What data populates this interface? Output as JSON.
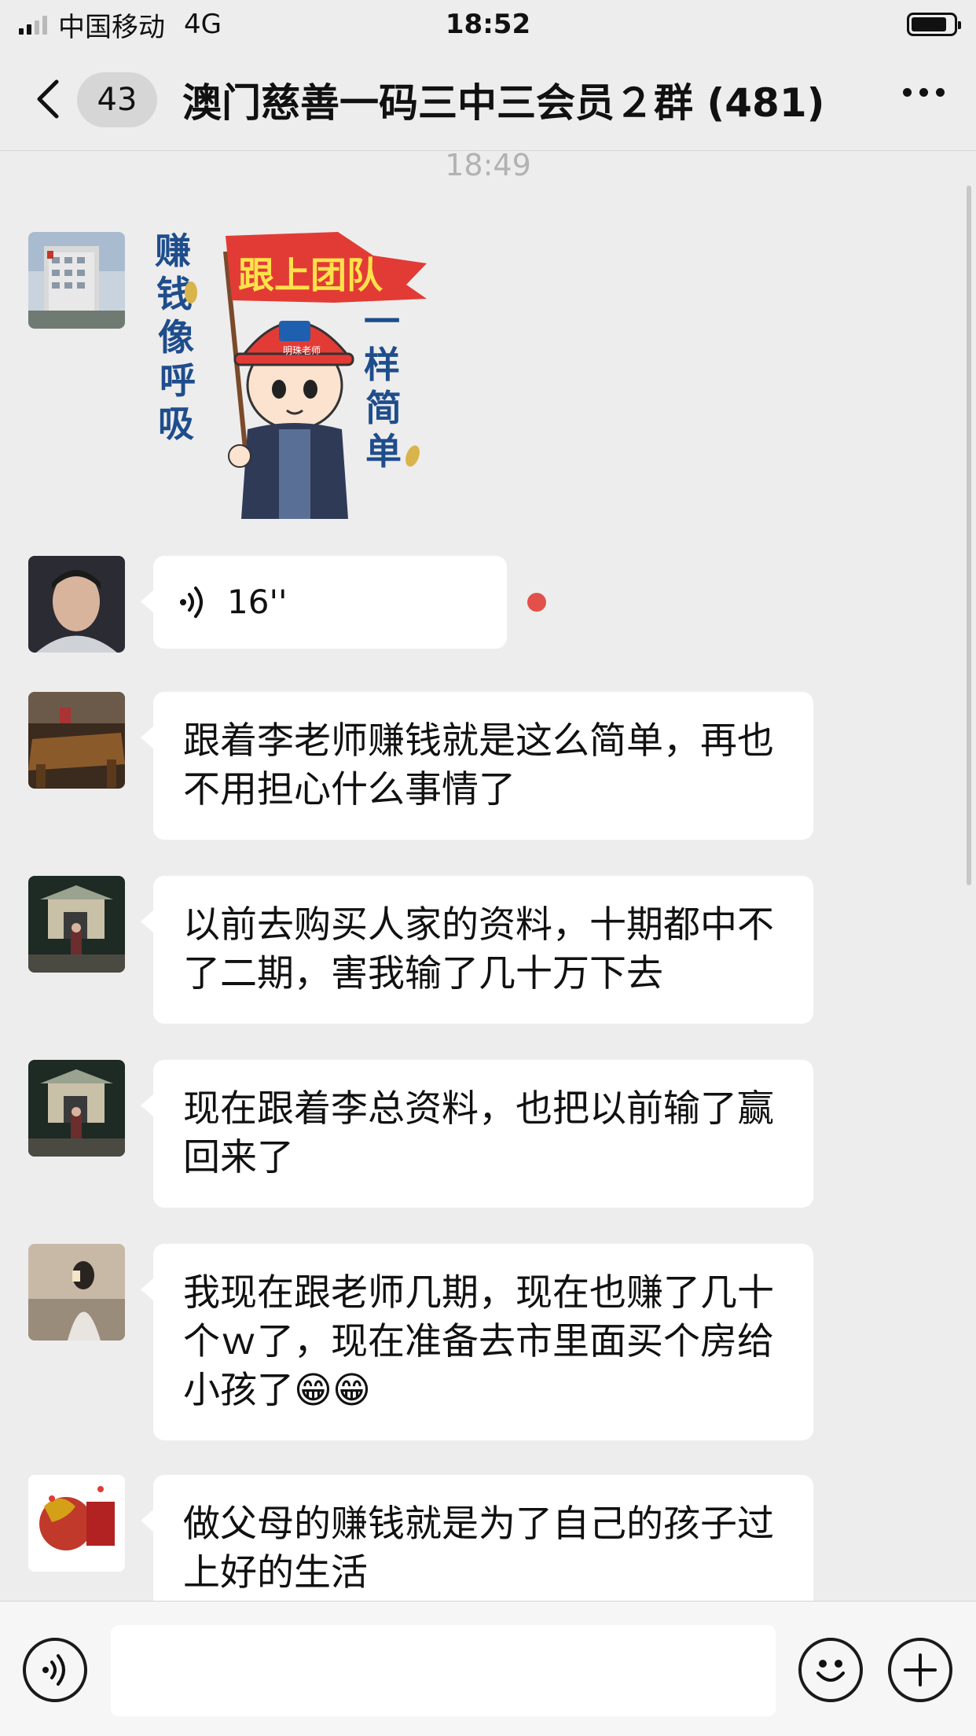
{
  "status_bar": {
    "carrier": "中国移动",
    "network": "4G",
    "time": "18:52"
  },
  "nav": {
    "unread_count": "43",
    "title": "澳门慈善一码三中三会员２群 (481)"
  },
  "chat": {
    "timestamp": "18:49",
    "sticker": {
      "banner_text": "跟上团队",
      "left_text": "赚钱像呼吸",
      "right_text": "一样简单",
      "cap_text": "明珠老师"
    },
    "voice_message": {
      "duration": "16''"
    },
    "messages": [
      {
        "text": "跟着李老师赚钱就是这么简单，再也不用担心什么事情了"
      },
      {
        "text": "以前去购买人家的资料，十期都中不了二期，害我输了几十万下去"
      },
      {
        "text": "现在跟着李总资料，也把以前输了赢回来了"
      },
      {
        "text": "我现在跟老师几期，现在也赚了几十个ｗ了，现在准备去市里面买个房给小孩了😁😁"
      },
      {
        "text": "做父母的赚钱就是为了自己的孩子过上好的生活"
      }
    ]
  },
  "colors": {
    "background": "#ededed",
    "bubble": "#ffffff",
    "unread_dot": "#e2504a"
  }
}
